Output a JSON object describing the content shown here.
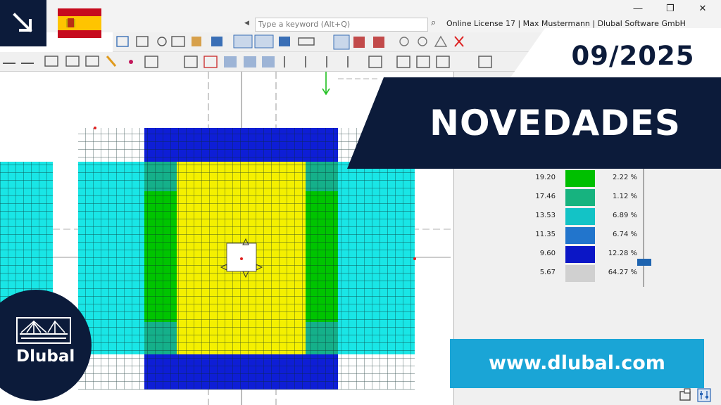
{
  "app": {
    "search_placeholder": "Type a keyword (Alt+Q)",
    "license_text": "Online License 17 | Max Mustermann | Dlubal Software GmbH",
    "window_controls": [
      "minimize-icon",
      "restore-icon",
      "close-icon"
    ]
  },
  "banner": {
    "date": "09/2025",
    "title": "NOVEDADES",
    "url": "www.dlubal.com",
    "logo_text": "Dlubal",
    "language_flag": "flag-spain-icon"
  },
  "legend": {
    "rows": [
      {
        "value": "19.20",
        "percent": "2.22 %",
        "color": "#00bf00"
      },
      {
        "value": "17.46",
        "percent": "1.12 %",
        "color": "#17b37f"
      },
      {
        "value": "13.53",
        "percent": "6.89 %",
        "color": "#13c3c6"
      },
      {
        "value": "11.35",
        "percent": "6.74 %",
        "color": "#2275cc"
      },
      {
        "value": "9.60",
        "percent": "12.28 %",
        "color": "#0b16c6"
      },
      {
        "value": "5.67",
        "percent": "64.27 %",
        "color": "#d0d0d0"
      }
    ]
  },
  "colors": {
    "navy": "#0c1b3a",
    "accent_cyan": "#1aa5d6",
    "mesh_yellow": "#f4f000",
    "mesh_green": "#00c400",
    "mesh_teal": "#15b08a",
    "mesh_cyan": "#19e6e6",
    "mesh_blue": "#0e1ed6"
  }
}
